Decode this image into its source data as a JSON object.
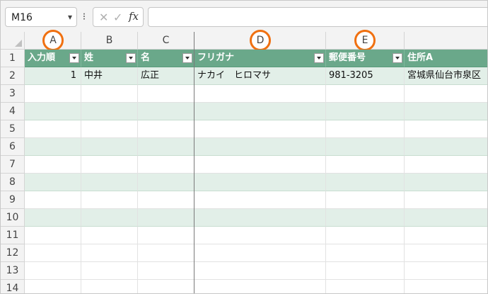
{
  "formula_bar": {
    "name_box": "M16",
    "separator": "⁝",
    "cancel_icon": "✕",
    "enter_icon": "✓",
    "fx_label": "fx",
    "formula_value": ""
  },
  "columns": [
    "A",
    "B",
    "C",
    "D",
    "E",
    ""
  ],
  "rows": [
    "1",
    "2",
    "3",
    "4",
    "5",
    "6",
    "7",
    "8",
    "9",
    "10",
    "11",
    "12",
    "13",
    "14"
  ],
  "header_row": [
    "入力順",
    "姓",
    "名",
    "フリガナ",
    "郵便番号",
    "住所A"
  ],
  "data_row": {
    "order": "1",
    "last_name": "中井",
    "first_name": "広正",
    "furigana": "ナカイ　ヒロマサ",
    "postal": "981-3205",
    "address": "宮城県仙台市泉区"
  },
  "colors": {
    "header_green": "#6aa88a",
    "band_green": "#e2efe8",
    "highlight_orange": "#f07010"
  }
}
